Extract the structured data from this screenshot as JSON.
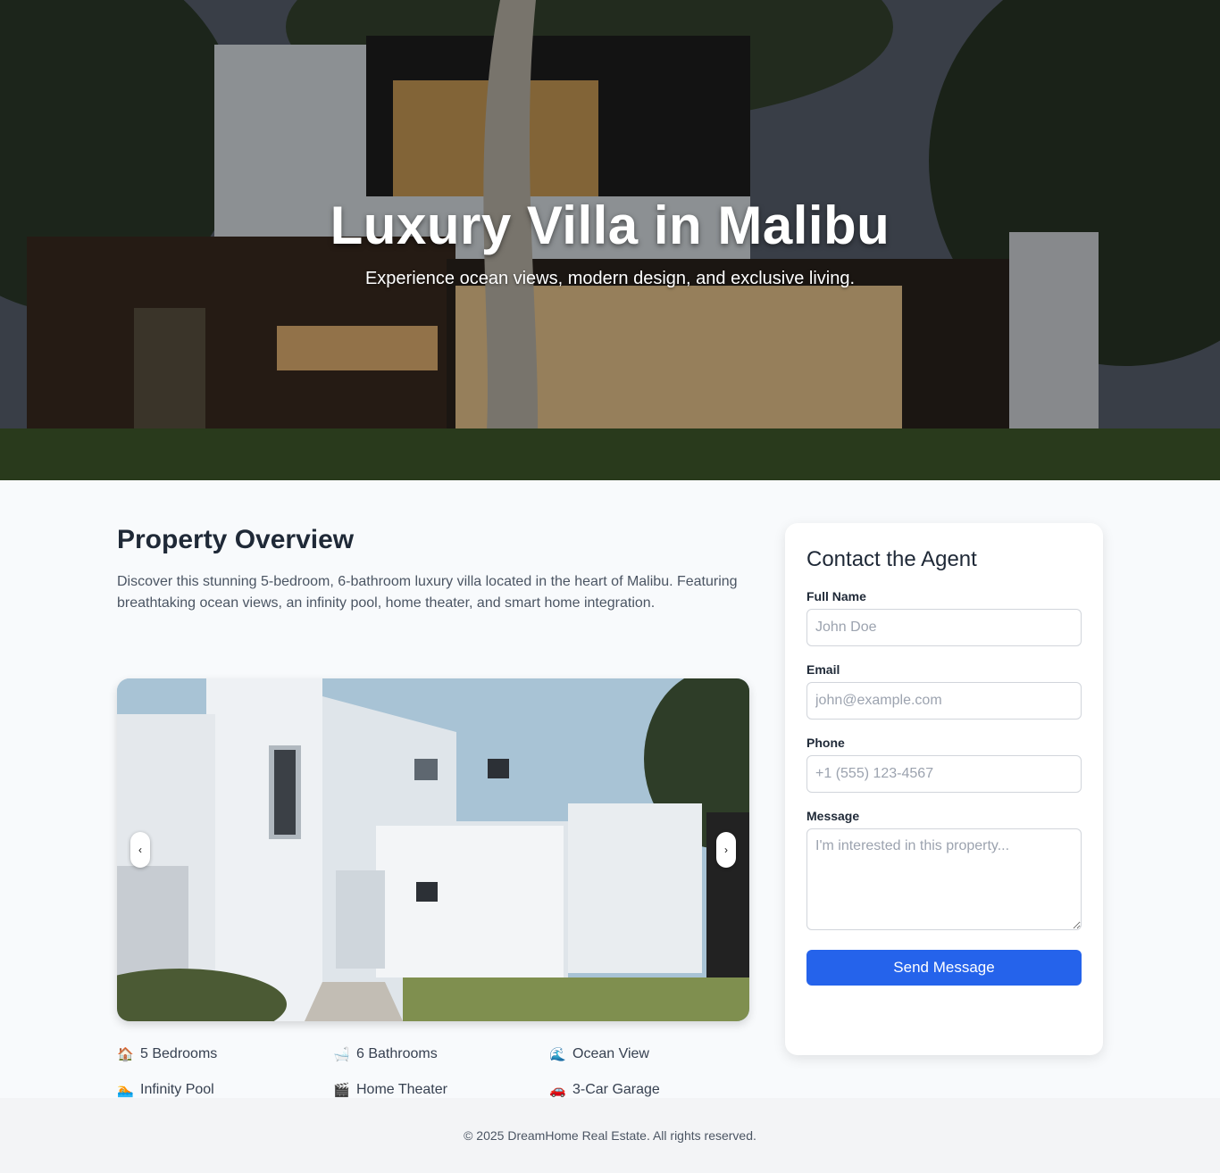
{
  "hero": {
    "title": "Luxury Villa in Malibu",
    "subtitle": "Experience ocean views, modern design, and exclusive living."
  },
  "overview": {
    "title": "Property Overview",
    "description": "Discover this stunning 5-bedroom, 6-bathroom luxury villa located in the heart of Malibu. Featuring breathtaking ocean views, an infinity pool, home theater, and smart home integration."
  },
  "carousel": {
    "prev_label": "‹",
    "next_label": "›"
  },
  "features": [
    {
      "icon": "house-icon",
      "glyph": "🏠",
      "label": "5 Bedrooms"
    },
    {
      "icon": "bathtub-icon",
      "glyph": "🛁",
      "label": "6 Bathrooms"
    },
    {
      "icon": "wave-icon",
      "glyph": "🌊",
      "label": "Ocean View"
    },
    {
      "icon": "pool-icon",
      "glyph": "🏊",
      "label": "Infinity Pool"
    },
    {
      "icon": "clapper-icon",
      "glyph": "🎬",
      "label": "Home Theater"
    },
    {
      "icon": "car-icon",
      "glyph": "🚗",
      "label": "3-Car Garage"
    }
  ],
  "contact": {
    "title": "Contact the Agent",
    "name_label": "Full Name",
    "name_placeholder": "John Doe",
    "email_label": "Email",
    "email_placeholder": "john@example.com",
    "phone_label": "Phone",
    "phone_placeholder": "+1 (555) 123-4567",
    "message_label": "Message",
    "message_placeholder": "I'm interested in this property...",
    "submit_label": "Send Message"
  },
  "footer": {
    "copyright": "© 2025 DreamHome Real Estate. All rights reserved."
  },
  "colors": {
    "accent": "#2563eb",
    "page_bg": "#f8fafc",
    "footer_bg": "#f3f4f6"
  }
}
